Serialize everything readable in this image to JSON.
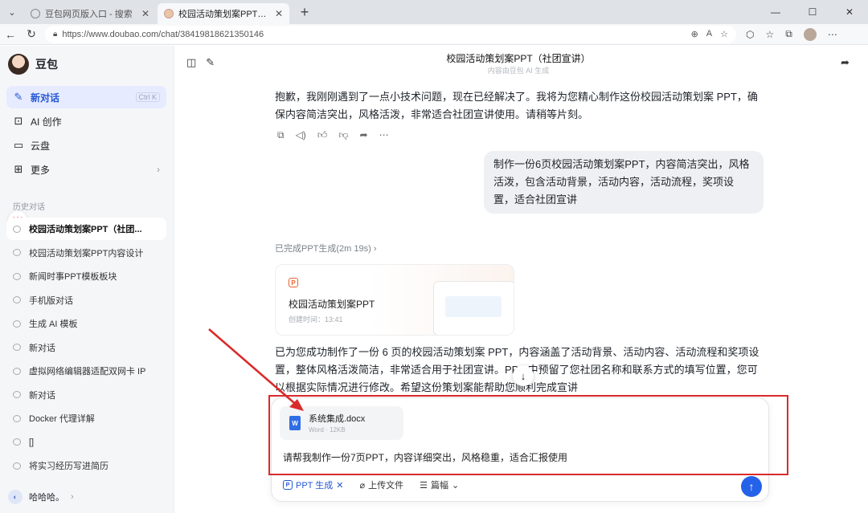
{
  "browser": {
    "tabs": [
      {
        "title": "豆包网页版入口 - 搜索",
        "active": false
      },
      {
        "title": "校园活动策划案PPT（社团宣讲）",
        "active": true
      }
    ],
    "new_tab_label": "+",
    "url": "https://www.doubao.com/chat/38419818621350146",
    "window_controls": {
      "minimize": "—",
      "maximize": "☐",
      "close": "✕"
    }
  },
  "sidebar": {
    "brand": "豆包",
    "menu": [
      {
        "label": "新对话",
        "icon": "new-chat-icon",
        "shortcut": "Ctrl K",
        "active": true
      },
      {
        "label": "AI 创作",
        "icon": "ai-create-icon"
      },
      {
        "label": "云盘",
        "icon": "folder-icon"
      },
      {
        "label": "更多",
        "icon": "grid-icon"
      }
    ],
    "history_title": "历史对话",
    "history": [
      "校园活动策划案PPT（社团...",
      "校园活动策划案PPT内容设计",
      "新闻时事PPT模板板块",
      "手机版对话",
      "生成 AI 模板",
      "新对话",
      "虚拟网络编辑器适配双网卡 IP",
      "新对话",
      "Docker 代理详解",
      "[]",
      "将实习经历写进简历"
    ],
    "user_name": "哈哈哈。"
  },
  "header": {
    "title": "校园活动策划案PPT（社团宣讲）",
    "subtitle": "内容由豆包 AI 生成"
  },
  "messages": {
    "assistant_1": "抱歉，我刚刚遇到了一点小技术问题，现在已经解决了。我将为您精心制作这份校园活动策划案 PPT，确保内容简洁突出，风格活泼，非常适合社团宣讲使用。请稍等片刻。",
    "user_1": "制作一份6页校园活动策划案PPT，内容简洁突出，风格活泼，包含活动背景，活动内容，活动流程，奖项设置，适合社团宣讲",
    "ppt_status": "已完成PPT生成(2m 19s)",
    "ppt_card": {
      "title": "校园活动策划案PPT",
      "time": "创建时间：13:41"
    },
    "assistant_2": "已为您成功制作了一份 6 页的校园活动策划案 PPT，内容涵盖了活动背景、活动内容、活动流程和奖项设置，整体风格活泼简洁，非常适合用于社团宣讲。PPT 中预留了您社团名称和联系方式的填写位置，您可以根据实际情况进行修改。希望这份策划案能帮助您顺利完成宣讲"
  },
  "composer": {
    "file": {
      "name": "系统集成.docx",
      "meta": "Word · 12KB"
    },
    "prompt": "请帮我制作一份7页PPT，内容详细突出，风格稳重，适合汇报使用",
    "tools": {
      "ppt": "PPT 生成",
      "upload": "上传文件",
      "length": "篇幅"
    }
  },
  "colors": {
    "accent": "#2462e9",
    "annotation": "#d92a2a"
  }
}
